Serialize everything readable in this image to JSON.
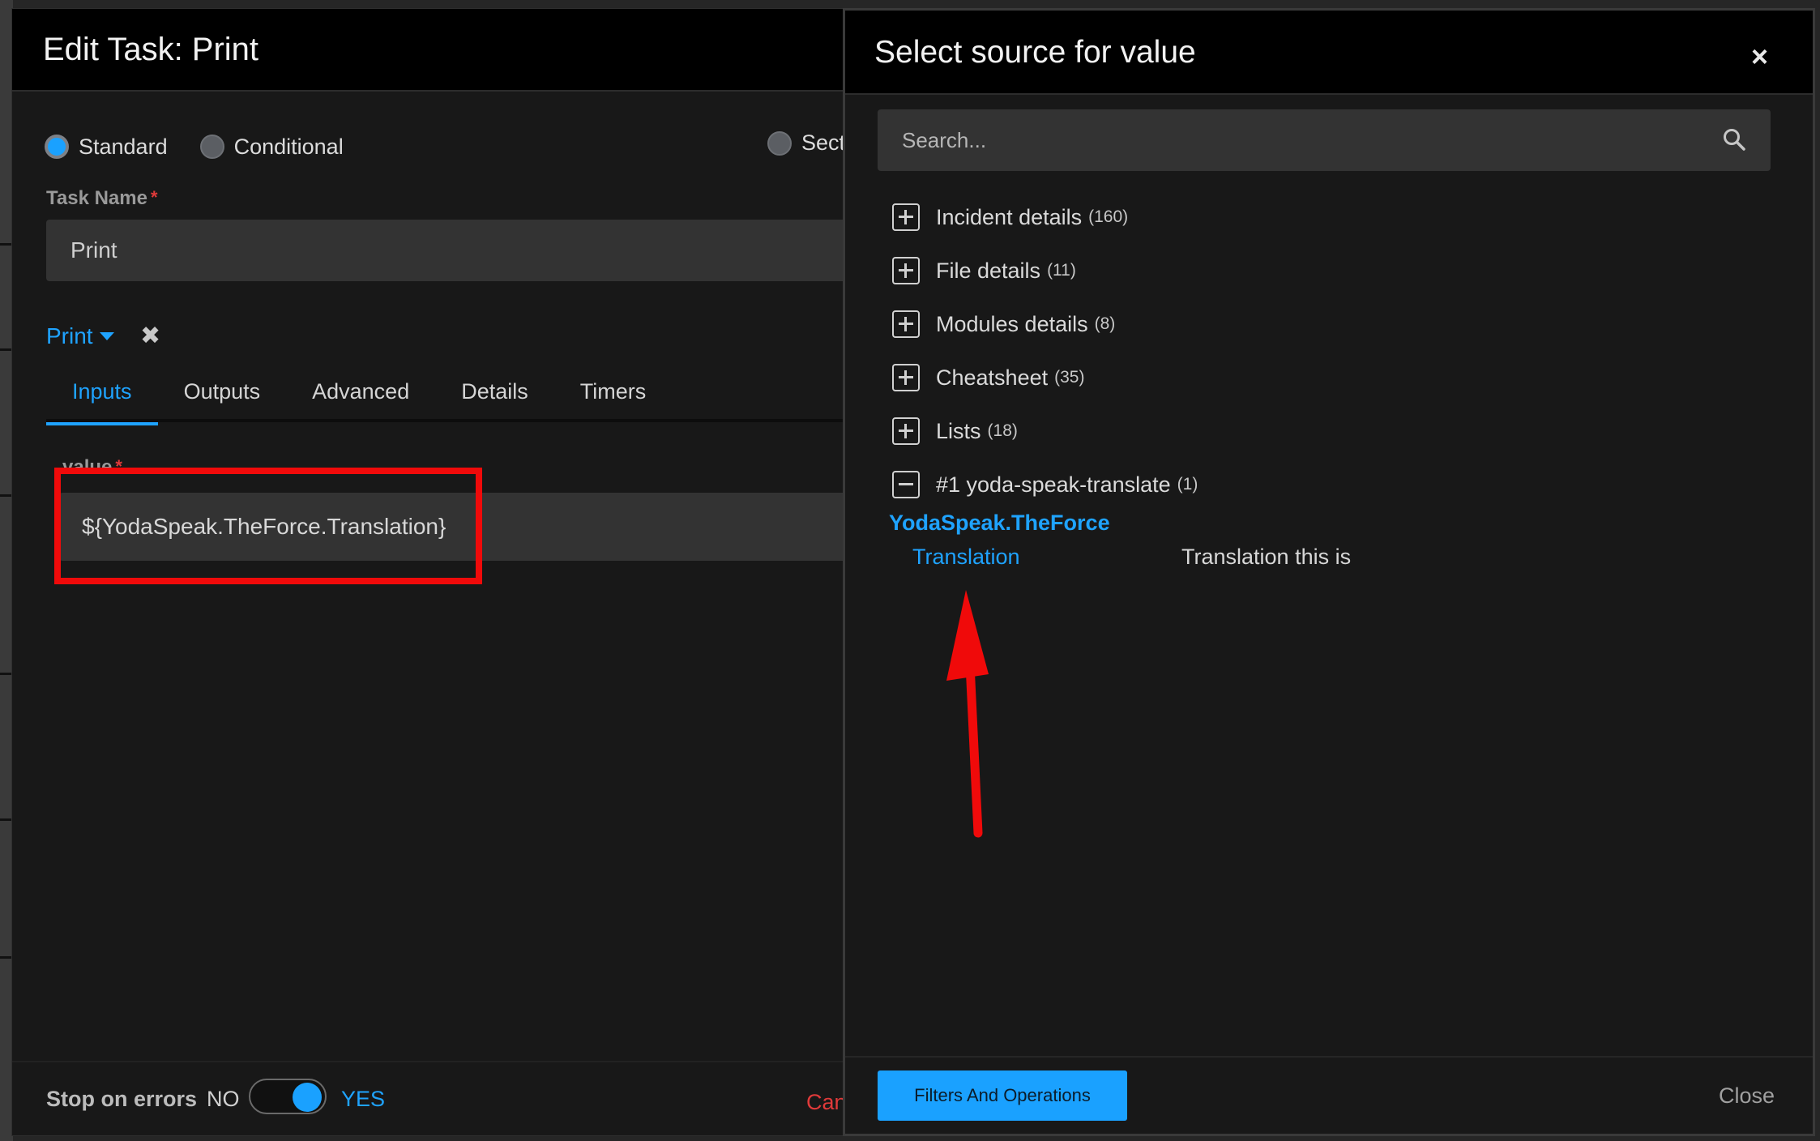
{
  "edit_panel": {
    "title": "Edit Task: Print",
    "task_type_options": [
      {
        "label": "Standard",
        "selected": true
      },
      {
        "label": "Conditional",
        "selected": false
      },
      {
        "label": "Sect",
        "selected": false
      }
    ],
    "task_name": {
      "label": "Task Name",
      "required_mark": "*",
      "value": "Print"
    },
    "script_dropdown": {
      "label": "Print"
    },
    "tabs": [
      "Inputs",
      "Outputs",
      "Advanced",
      "Details",
      "Timers"
    ],
    "active_tab": "Inputs",
    "value_field": {
      "label": "value",
      "required_mark": "*",
      "value": "${YodaSpeak.TheForce.Translation}"
    },
    "footer": {
      "stop_on_errors": "Stop on errors",
      "no": "NO",
      "yes": "YES",
      "cancel_partial": "Can"
    }
  },
  "source_panel": {
    "title": "Select source for value",
    "close_glyph": "×",
    "search": {
      "placeholder": "Search..."
    },
    "tree": [
      {
        "label": "Incident details",
        "count": "(160)",
        "expanded": false
      },
      {
        "label": "File details",
        "count": "(11)",
        "expanded": false
      },
      {
        "label": "Modules details",
        "count": "(8)",
        "expanded": false
      },
      {
        "label": "Cheatsheet",
        "count": "(35)",
        "expanded": false
      },
      {
        "label": "Lists",
        "count": "(18)",
        "expanded": false
      },
      {
        "label": "#1 yoda-speak-translate",
        "count": "(1)",
        "expanded": true
      }
    ],
    "result": {
      "parent": "YodaSpeak.TheForce",
      "child_key": "Translation",
      "child_value": "Translation this is"
    },
    "footer": {
      "filters_button": "Filters And Operations",
      "close_button": "Close"
    }
  },
  "colors": {
    "accent": "#1aa1ff",
    "highlight": "#f00a0a",
    "danger": "#e03a3a"
  }
}
